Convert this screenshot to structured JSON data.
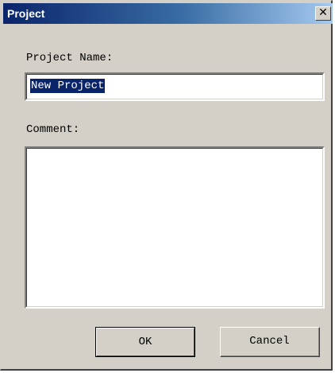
{
  "window": {
    "title": "Project",
    "close_glyph": "✕"
  },
  "form": {
    "project_name_label": "Project Name:",
    "project_name_value": "New Project",
    "comment_label": "Comment:",
    "comment_value": ""
  },
  "buttons": {
    "ok_label": "OK",
    "cancel_label": "Cancel"
  },
  "colors": {
    "title_bar": "#0a246a",
    "selection_highlight": "#0a246a",
    "dialog_face": "#d4d0c8"
  },
  "icons": {
    "close": "close-icon"
  }
}
